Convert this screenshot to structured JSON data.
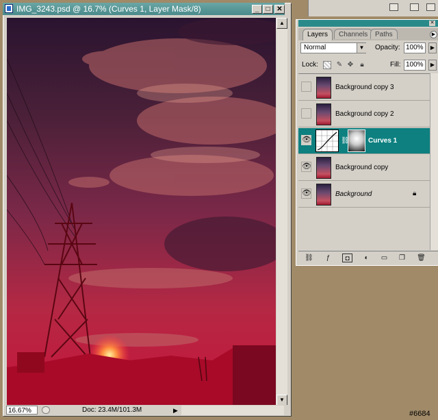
{
  "document_window": {
    "title": "IMG_3243.psd @ 16.7% (Curves 1, Layer Mask/8)",
    "minimize_glyph": "_",
    "maximize_glyph": "□",
    "close_glyph": "✕",
    "zoom_level": "16.67%",
    "doc_size": "Doc: 23.4M/101.3M",
    "status_menu_glyph": "▶",
    "scroll_up_glyph": "▲",
    "scroll_down_glyph": "▼"
  },
  "layers_panel": {
    "tabs": [
      {
        "label": "Layers",
        "active": true
      },
      {
        "label": "Channels",
        "active": false
      },
      {
        "label": "Paths",
        "active": false
      }
    ],
    "blend_mode": "Normal",
    "opacity_label": "Opacity:",
    "opacity_value": "100%",
    "lock_label": "Lock:",
    "fill_label": "Fill:",
    "fill_value": "100%",
    "layers": [
      {
        "name": "Background copy 3",
        "visible": false,
        "selected": false,
        "type": "pixel"
      },
      {
        "name": "Background copy 2",
        "visible": false,
        "selected": false,
        "type": "pixel"
      },
      {
        "name": "Curves 1",
        "visible": true,
        "selected": true,
        "type": "adjustment"
      },
      {
        "name": "Background copy",
        "visible": true,
        "selected": false,
        "type": "pixel"
      },
      {
        "name": "Background",
        "visible": true,
        "selected": false,
        "type": "background",
        "locked": true
      }
    ],
    "bottom_icons": [
      "link-layers-icon",
      "layer-style-icon",
      "layer-mask-icon",
      "adjustment-layer-icon",
      "new-group-icon",
      "new-layer-icon",
      "trash-icon"
    ]
  },
  "watermark": "#6684",
  "colors": {
    "selection": "#0e8080",
    "titlebar": "#4a8a8a",
    "desktop": "#a08a68"
  }
}
